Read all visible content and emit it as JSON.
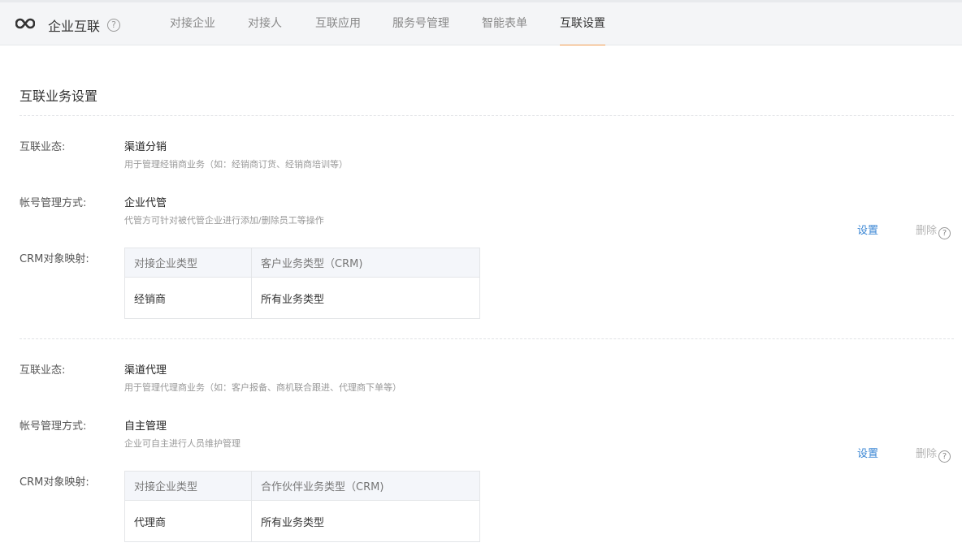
{
  "header": {
    "brand": "企业互联",
    "help": "?",
    "tabs": [
      {
        "label": "对接企业"
      },
      {
        "label": "对接人"
      },
      {
        "label": "互联应用"
      },
      {
        "label": "服务号管理"
      },
      {
        "label": "智能表单"
      },
      {
        "label": "互联设置",
        "active": true
      }
    ]
  },
  "page": {
    "section_title": "互联业务设置"
  },
  "labels": {
    "business_type": "互联业态:",
    "account_mode": "帐号管理方式:",
    "crm_mapping": "CRM对象映射:",
    "settings": "设置",
    "delete": "删除",
    "help": "?"
  },
  "entries": [
    {
      "business_type": "渠道分销",
      "business_desc": "用于管理经销商业务（如：经销商订货、经销商培训等）",
      "account_mode": "企业代管",
      "account_desc": "代管方可针对被代管企业进行添加/删除员工等操作",
      "table": {
        "headers": [
          "对接企业类型",
          "客户业务类型（CRM)"
        ],
        "rows": [
          [
            "经销商",
            "所有业务类型"
          ]
        ]
      }
    },
    {
      "business_type": "渠道代理",
      "business_desc": "用于管理代理商业务（如：客户报备、商机联合跟进、代理商下单等）",
      "account_mode": "自主管理",
      "account_desc": "企业可自主进行人员维护管理",
      "table": {
        "headers": [
          "对接企业类型",
          "合作伙伴业务类型（CRM)"
        ],
        "rows": [
          [
            "代理商",
            "所有业务类型"
          ]
        ]
      }
    }
  ]
}
